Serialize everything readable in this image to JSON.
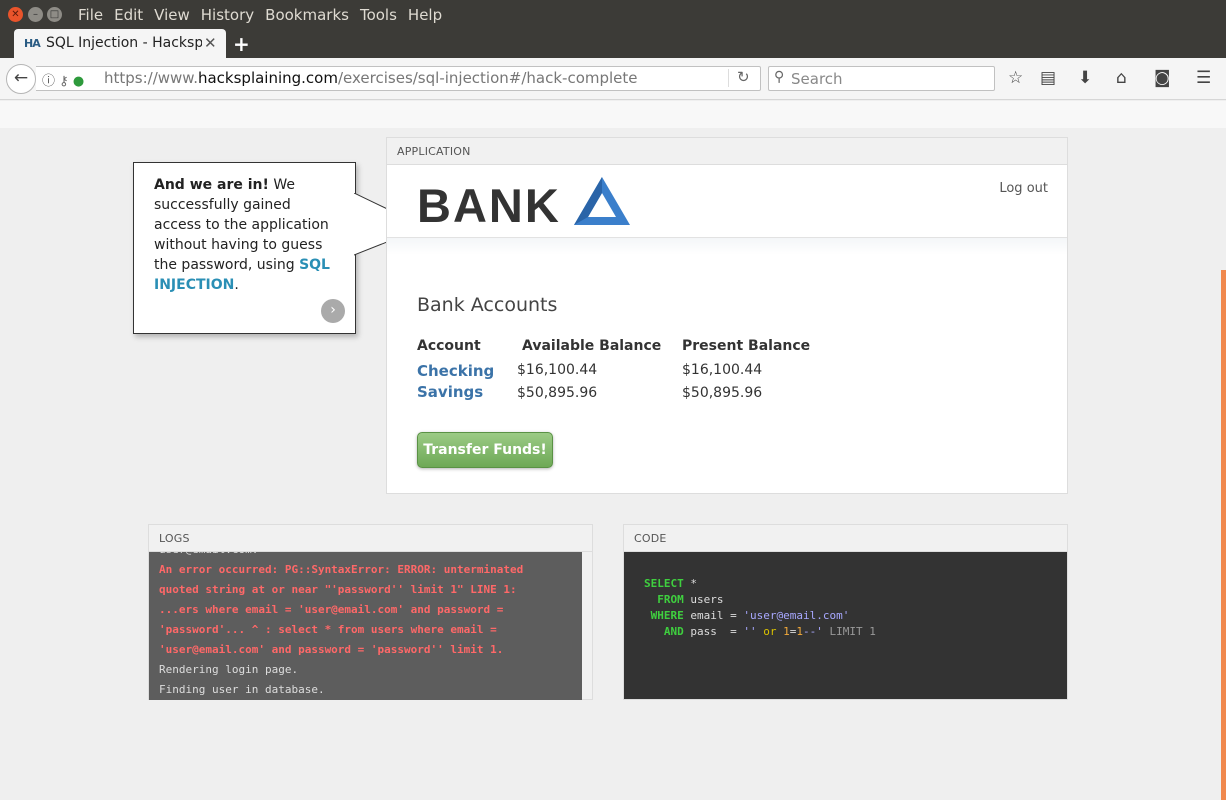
{
  "browser": {
    "menu": [
      "File",
      "Edit",
      "View",
      "History",
      "Bookmarks",
      "Tools",
      "Help"
    ],
    "tab_title": "SQL Injection - Hacksplaining",
    "favicon": "HA",
    "url_prefix": "https://www.",
    "url_domain": "hacksplaining.com",
    "url_path": "/exercises/sql-injection#/hack-complete",
    "search_placeholder": "Search"
  },
  "callout": {
    "lead": "And we are in!",
    "body": " We successfully gained access to the application without having to guess the password, using ",
    "link": "SQL INJECTION",
    "end": "."
  },
  "application": {
    "panel_title": "APPLICATION",
    "logo_text": "BANK",
    "logout": "Log out",
    "heading": "Bank Accounts",
    "headers": {
      "account": "Account",
      "available": "Available Balance",
      "present": "Present Balance"
    },
    "accounts": [
      {
        "name": "Checking",
        "available": "$16,100.44",
        "present": "$16,100.44"
      },
      {
        "name": "Savings",
        "available": "$50,895.96",
        "present": "$50,895.96"
      }
    ],
    "transfer_button": "Transfer Funds!"
  },
  "logs": {
    "panel_title": "LOGS",
    "top_partial": "user@email.com.",
    "error_lines": [
      "An error occurred: PG::SyntaxError: ERROR: unterminated",
      "quoted string at or near \"'password'' limit 1\" LINE 1:",
      "...ers where email = 'user@email.com' and password =",
      "'password'... ^ : select * from users where email =",
      "'user@email.com' and password = 'password'' limit 1."
    ],
    "info_lines": [
      "Rendering login page.",
      "Finding user in database."
    ]
  },
  "code": {
    "panel_title": "CODE",
    "select_kw": "SELECT",
    "select_rest": " *",
    "from_kw": "FROM",
    "from_rest": " users",
    "where_kw": "WHERE",
    "where_rest": " email = ",
    "where_str": "'user@email.com'",
    "and_kw": "AND",
    "and_rest": " pass  = ",
    "and_str1": "''",
    "and_or": " or ",
    "and_num1": "1",
    "and_eq": "=",
    "and_num2": "1",
    "and_str2": "--'",
    "and_tail": " LIMIT 1"
  }
}
